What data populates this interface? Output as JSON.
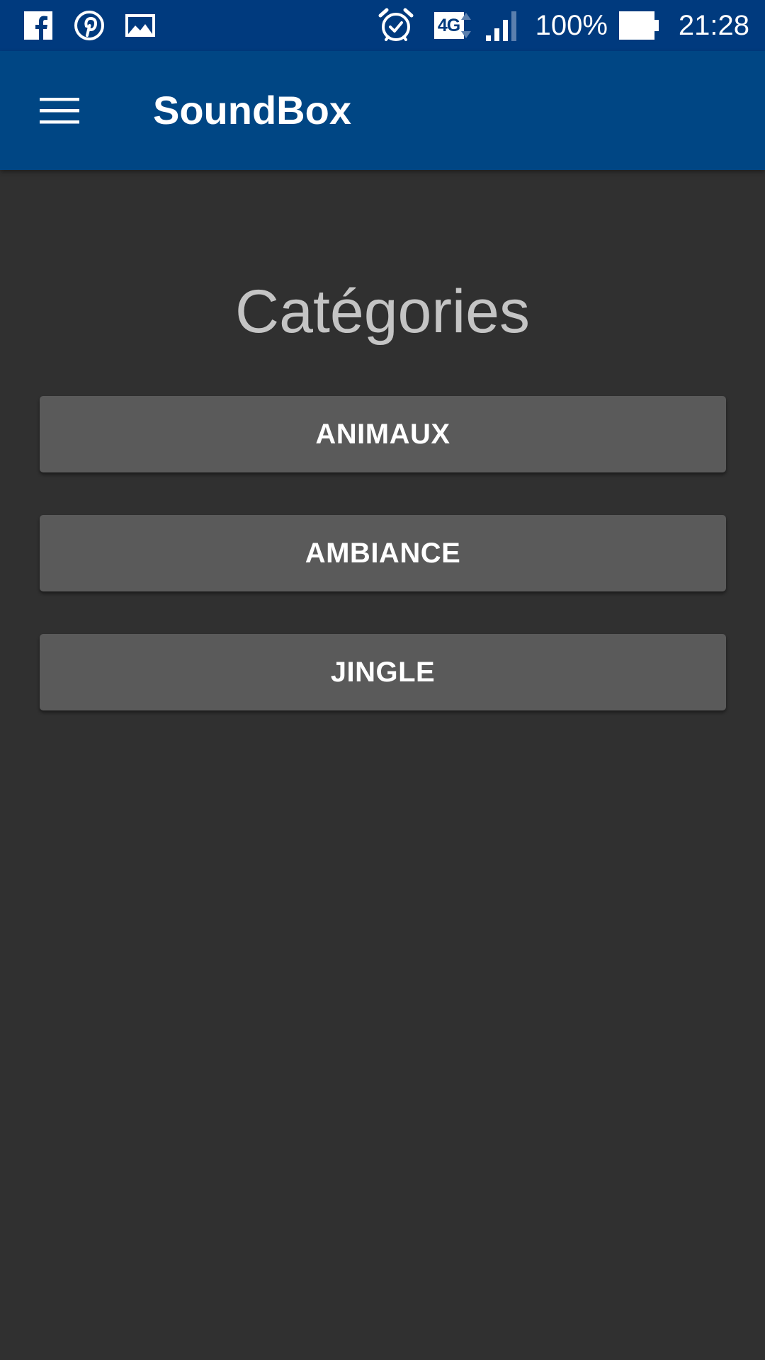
{
  "status_bar": {
    "left_icons": [
      "facebook-icon",
      "pinterest-icon",
      "gallery-icon"
    ],
    "right_icons": [
      "alarm-icon",
      "network-4g-icon",
      "signal-icon",
      "battery-icon"
    ],
    "network_label": "4G",
    "battery_percent": "100%",
    "battery_level": 1.0,
    "time": "21:28"
  },
  "app_bar": {
    "menu_icon": "hamburger-menu-icon",
    "title": "SoundBox"
  },
  "main": {
    "heading": "Catégories",
    "categories": [
      {
        "label": "ANIMAUX"
      },
      {
        "label": "AMBIANCE"
      },
      {
        "label": "JINGLE"
      }
    ]
  },
  "colors": {
    "status_bar_bg": "#003a7e",
    "app_bar_bg": "#004684",
    "background": "#303030",
    "button_bg": "#5a5a5a",
    "heading_text": "#c4c4c4"
  }
}
